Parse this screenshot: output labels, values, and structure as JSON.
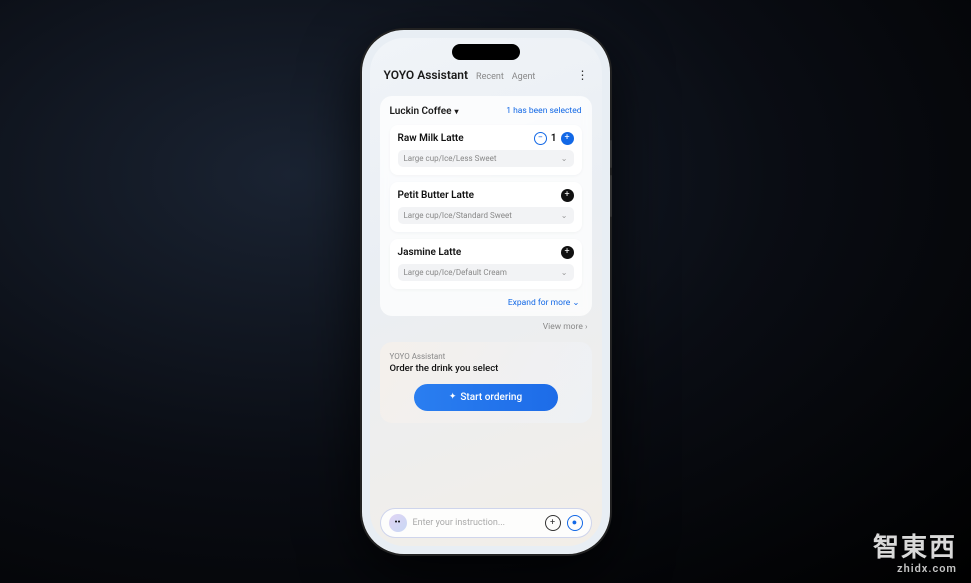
{
  "header": {
    "title": "YOYO Assistant",
    "tabs": [
      "Recent",
      "Agent"
    ]
  },
  "card": {
    "store": "Luckin Coffee",
    "selected_text": "1 has been selected",
    "items": [
      {
        "name": "Raw Milk Latte",
        "options": "Large cup/Ice/Less Sweet",
        "qty": 1,
        "has_counter": true
      },
      {
        "name": "Petit Butter Latte",
        "options": "Large cup/Ice/Standard Sweet",
        "has_counter": false
      },
      {
        "name": "Jasmine Latte",
        "options": "Large cup/Ice/Default Cream",
        "has_counter": false
      }
    ],
    "expand": "Expand for more",
    "view_more": "View more"
  },
  "action": {
    "sub": "YOYO Assistant",
    "title": "Order the drink you select",
    "button": "Start ordering"
  },
  "input": {
    "placeholder": "Enter your instruction..."
  },
  "watermark": {
    "cn": "智東西",
    "en": "zhidx.com"
  }
}
